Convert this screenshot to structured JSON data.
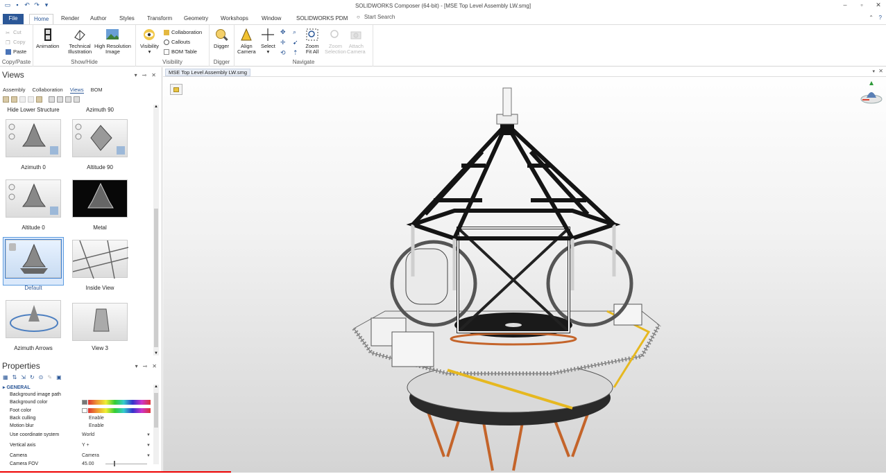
{
  "window": {
    "title": "SOLIDWORKS Composer (64-bit) - [MSE Top Level Assembly LW.smg]"
  },
  "tabs": [
    "File",
    "Home",
    "Render",
    "Author",
    "Styles",
    "Transform",
    "Geometry",
    "Workshops",
    "Window",
    "SOLIDWORKS PDM"
  ],
  "search": {
    "placeholder": "Start Search"
  },
  "ribbon": {
    "copy_paste": {
      "cut": "Cut",
      "copy": "Copy",
      "paste": "Paste",
      "label": "Copy/Paste"
    },
    "show_hide": {
      "animation": "Animation",
      "technical_line1": "Technical",
      "technical_line2": "Illustration",
      "hires_line1": "High Resolution",
      "hires_line2": "Image",
      "label": "Show/Hide"
    },
    "visibility": {
      "visibility": "Visibility",
      "collaboration": "Collaboration",
      "callouts": "Callouts",
      "bom_table": "BOM Table",
      "label": "Visibility"
    },
    "digger": {
      "digger": "Digger",
      "label": "Digger"
    },
    "navigate": {
      "align_line1": "Align",
      "align_line2": "Camera",
      "select": "Select",
      "zoom_line1": "Zoom",
      "zoom_line2": "Fit All",
      "zoomsel_line1": "Zoom",
      "zoomsel_line2": "Selection",
      "attach_line1": "Attach",
      "attach_line2": "Camera",
      "label": "Navigate"
    }
  },
  "views_pane": {
    "title": "Views",
    "tabs": [
      "Assembly",
      "Collaboration",
      "Views",
      "BOM"
    ],
    "top_labels": [
      "Hide Lower Structure",
      "Azimuth 90"
    ],
    "items": [
      {
        "label": "Azimuth 0"
      },
      {
        "label": "Altitude 90"
      },
      {
        "label": "Altitude 0"
      },
      {
        "label": "Metal"
      },
      {
        "label": "Default"
      },
      {
        "label": "Inside View"
      },
      {
        "label": "Azimuth Arrows"
      },
      {
        "label": "View 3"
      }
    ]
  },
  "properties_pane": {
    "title": "Properties",
    "section": "GENERAL",
    "rows": [
      {
        "name": "Background image path",
        "value": ""
      },
      {
        "name": "Background color",
        "value": ""
      },
      {
        "name": "Foot color",
        "value": ""
      },
      {
        "name": "Back culling",
        "value": "Enable"
      },
      {
        "name": "Motion blur",
        "value": "Enable"
      },
      {
        "name": "Use coordinate system",
        "value": "World"
      },
      {
        "name": "Vertical axis",
        "value": "Y +"
      },
      {
        "name": "Camera",
        "value": "Camera"
      },
      {
        "name": "Camera FOV",
        "value": "45.00"
      }
    ]
  },
  "document": {
    "tab": "MSE Top Level Assembly LW.smg"
  },
  "colors": {
    "accent": "#2b5797",
    "selection": "#5b9be0",
    "frame": "#141414",
    "deck": "#2a2a2a",
    "legs": "#c4642a",
    "stairs": "#e6b820"
  }
}
